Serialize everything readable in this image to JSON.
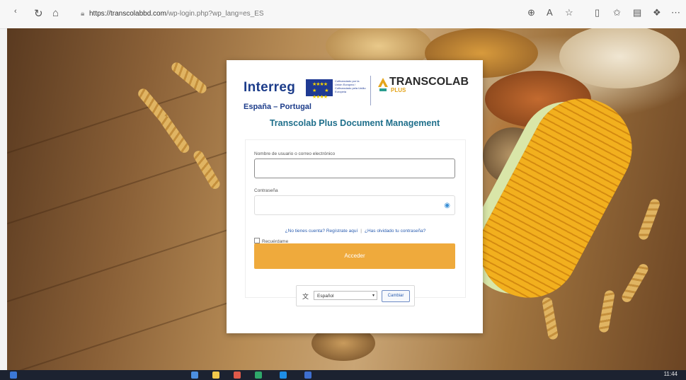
{
  "browser": {
    "url_host": "https://transcolabbd.com",
    "url_path": "/wp-login.php?wp_lang=es_ES",
    "nav_icons": [
      "back-icon",
      "refresh-icon",
      "home-icon"
    ],
    "toolbar_icons": [
      "zoom-icon",
      "read-aloud-icon",
      "favorite-icon",
      "split-screen-icon",
      "favorites-bar-icon",
      "collections-icon",
      "extensions-icon",
      "more-icon"
    ]
  },
  "logos": {
    "interreg": "Interreg",
    "region": "España – Portugal",
    "eu_text": "Cofinanciado por la Unión Europea / Cofinanciado pela União Europeia",
    "transcolab": "TRANSCOLAB",
    "plus": "PLUS"
  },
  "title": "Transcolab Plus Document Management",
  "form": {
    "username_label": "Nombre de usuario o correo electrónico",
    "username_value": "",
    "password_label": "Contraseña",
    "password_value": "",
    "register_link": "¿No tienes cuenta? Regístrate aquí",
    "separator": "|",
    "lost_password_link": "¿Has olvidado tu contraseña?",
    "remember_label": "Recuérdame",
    "submit_label": "Acceder"
  },
  "language": {
    "selected": "Español",
    "change_button": "Cambiar"
  },
  "taskbar": {
    "clock": "11:44"
  },
  "colors": {
    "accent": "#efaa3c",
    "title": "#1f6f8b",
    "interreg_blue": "#1c3c8a"
  }
}
